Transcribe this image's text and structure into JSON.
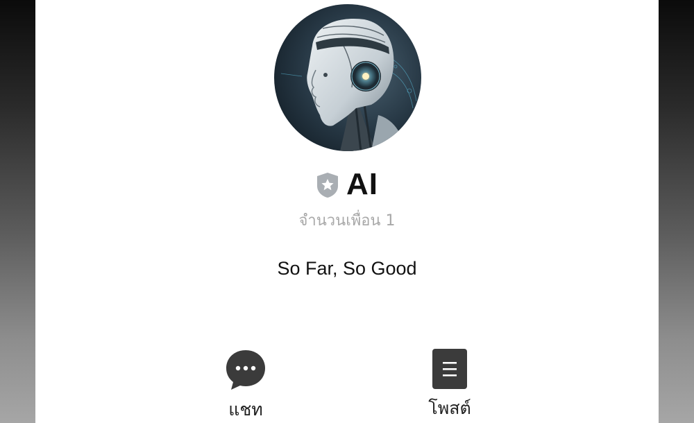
{
  "profile": {
    "name": "AI",
    "friends_label": "จำนวนเพื่อน 1",
    "status_message": "So Far, So Good",
    "avatar_icon": "robot-avatar",
    "badge_icon": "shield-star-icon"
  },
  "actions": [
    {
      "label": "แชท",
      "icon": "chat-bubble-icon"
    },
    {
      "label": "โพสต์",
      "icon": "post-document-icon"
    }
  ],
  "colors": {
    "icon_dark": "#3b3b3b",
    "badge_gray": "#a9aeb3",
    "secondary_text": "#a8a8a8"
  }
}
